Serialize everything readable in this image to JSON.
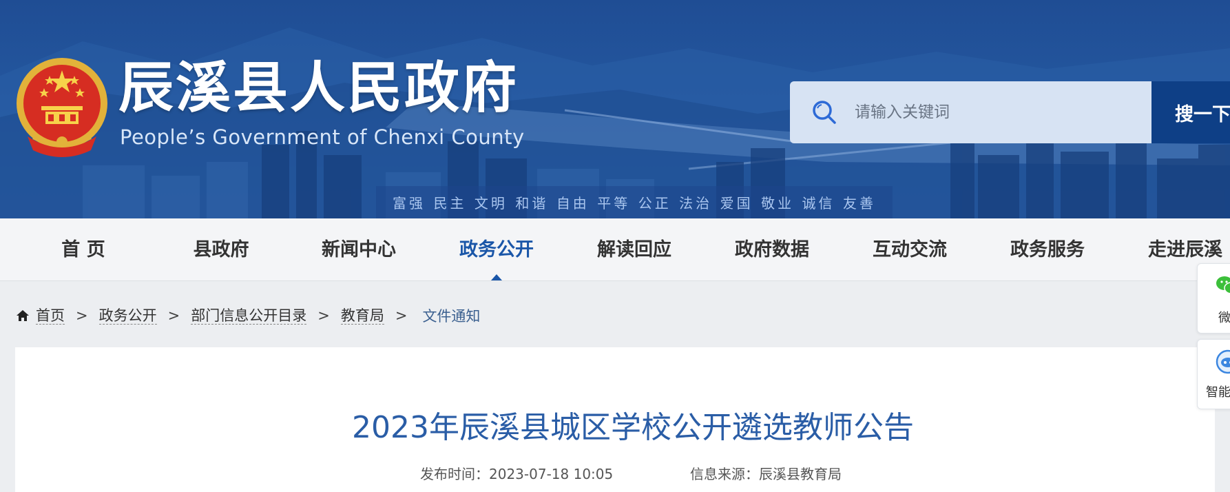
{
  "header": {
    "title": "辰溪县人民政府",
    "subtitle": "People’s Government of Chenxi County",
    "core_values": [
      "富强",
      "民主",
      "文明",
      "和谐",
      "自由",
      "平等",
      "公正",
      "法治",
      "爱国",
      "敬业",
      "诚信",
      "友善"
    ]
  },
  "search": {
    "placeholder": "请输入关键词",
    "button_label": "搜一下"
  },
  "nav": {
    "items": [
      {
        "label": "首 页"
      },
      {
        "label": "县政府"
      },
      {
        "label": "新闻中心"
      },
      {
        "label": "政务公开",
        "active": true
      },
      {
        "label": "解读回应"
      },
      {
        "label": "政府数据"
      },
      {
        "label": "互动交流"
      },
      {
        "label": "政务服务"
      },
      {
        "label": "走进辰溪"
      }
    ]
  },
  "breadcrumb": {
    "items": [
      "首页",
      "政务公开",
      "部门信息公开目录",
      "教育局"
    ],
    "separator": ">",
    "current": "文件通知"
  },
  "article": {
    "title": "2023年辰溪县城区学校公开遴选教师公告",
    "publish_label": "发布时间：",
    "publish_time": "2023-07-18 10:05",
    "source_label": "信息来源：",
    "source": "辰溪县教育局"
  },
  "float_sidebar": {
    "wechat_label": "微",
    "smart_label": "智能"
  },
  "colors": {
    "header_blue": "#24579f",
    "search_button": "#0e3f86",
    "nav_active": "#1a56a8",
    "article_title": "#2a5da6"
  }
}
